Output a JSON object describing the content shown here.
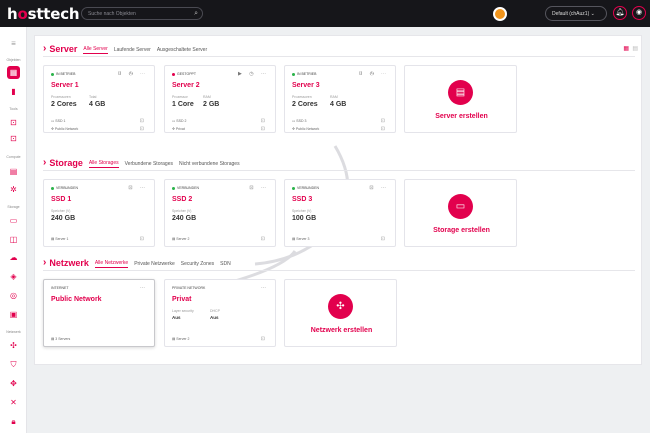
{
  "header": {
    "logo_pre": "h",
    "logo_o": "o",
    "logo_post": "sttech",
    "search_placeholder": "Suche nach Objekten",
    "project": "Default (chAuz1)"
  },
  "sidebar": {
    "cat_objects": "Objekten",
    "cat_tools": "Tools",
    "cat_compute": "Compute",
    "cat_storage": "Storage",
    "cat_network": "Netzwerk"
  },
  "server": {
    "title": "Server",
    "tabs": [
      "Alle Server",
      "Laufende Server",
      "Ausgeschaltete Server"
    ],
    "cards": [
      {
        "status": "IN BETRIEB",
        "status_color": "#2bb34a",
        "name": "Server 1",
        "cpu_label": "Prozessoren",
        "cpu": "2 Cores",
        "ram_label": "Total",
        "ram": "4 GB",
        "storage": "SSD 1",
        "network": "Public Network"
      },
      {
        "status": "GESTOPPT",
        "status_color": "#e2004d",
        "name": "Server 2",
        "cpu_label": "Prozessor",
        "cpu": "1 Core",
        "ram_label": "RAM",
        "ram": "2 GB",
        "storage": "SSD 2",
        "network": "Privat"
      },
      {
        "status": "IN BETRIEB",
        "status_color": "#2bb34a",
        "name": "Server 3",
        "cpu_label": "Prozessoren",
        "cpu": "2 Cores",
        "ram_label": "RAM",
        "ram": "4 GB",
        "storage": "SSD 3",
        "network": "Public Network"
      }
    ],
    "create": "Server erstellen"
  },
  "storage": {
    "title": "Storage",
    "tabs": [
      "Alle Storages",
      "Verbundene Storages",
      "Nicht verbundene Storages"
    ],
    "cards": [
      {
        "status": "VERBUNDEN",
        "status_color": "#2bb34a",
        "name": "SSD 1",
        "size_label": "Speicher (V)",
        "size": "240 GB",
        "server": "Server 1"
      },
      {
        "status": "VERBUNDEN",
        "status_color": "#2bb34a",
        "name": "SSD 2",
        "size_label": "Speicher (V)",
        "size": "240 GB",
        "server": "Server 2"
      },
      {
        "status": "VERBUNDEN",
        "status_color": "#2bb34a",
        "name": "SSD 3",
        "size_label": "Speicher (V)",
        "size": "100 GB",
        "server": "Server 3"
      }
    ],
    "create": "Storage erstellen"
  },
  "network": {
    "title": "Netzwerk",
    "tabs": [
      "Alle Netzwerke",
      "Private Netzwerke",
      "Security Zones",
      "SDN"
    ],
    "cards": [
      {
        "type": "INTERNET",
        "name": "Public Network",
        "servers": "3 Servers"
      },
      {
        "type": "PRIVATE NETWORK",
        "name": "Privat",
        "k1": "Layer security",
        "v1": "Aus",
        "k2": "DHCP",
        "v2": "Aus",
        "servers": "Server 2"
      }
    ],
    "create": "Netzwerk erstellen"
  },
  "colors": {
    "accent": "#e2004d",
    "running": "#2bb34a"
  }
}
